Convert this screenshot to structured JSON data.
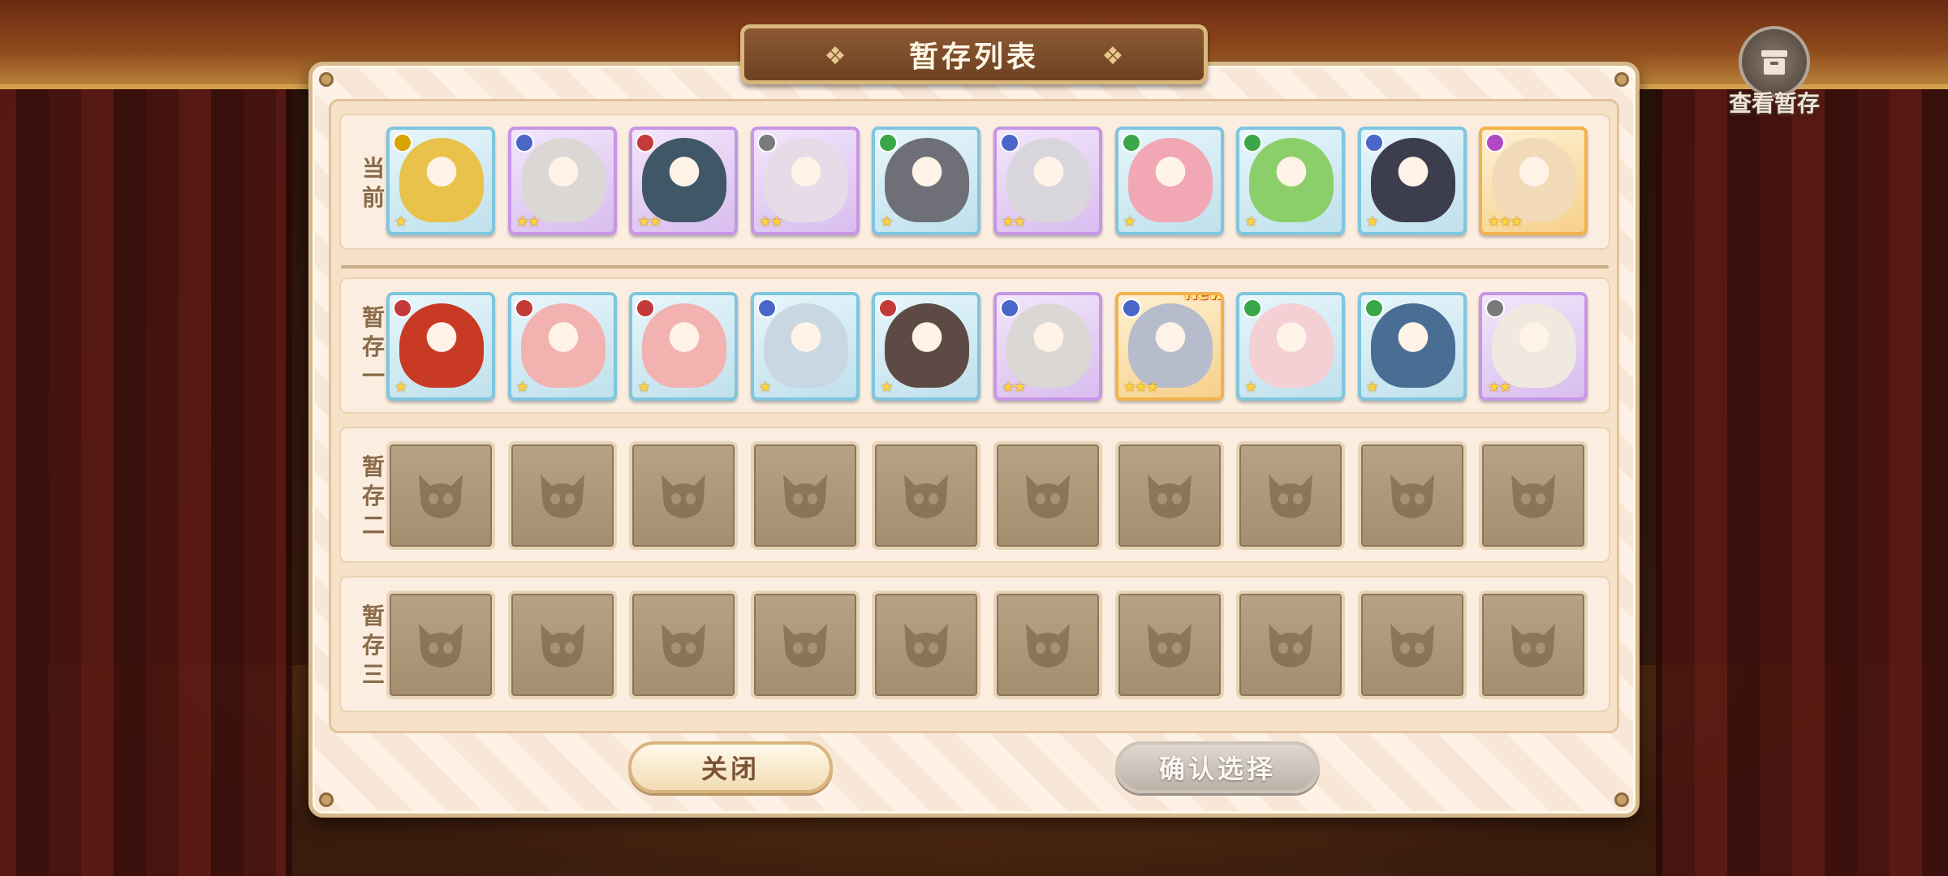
{
  "window": {
    "title": "暂存列表"
  },
  "view_stash_button": {
    "label": "查看暂存",
    "icon": "box-icon"
  },
  "rows": [
    {
      "label": [
        "当",
        "前"
      ],
      "slots": [
        {
          "rarity": 1,
          "stars": "★",
          "portrait": "#e8c24a",
          "element": "#d9a300"
        },
        {
          "rarity": 2,
          "stars": "★★",
          "portrait": "#dad7d4",
          "element": "#4a66c9"
        },
        {
          "rarity": 2,
          "stars": "★★",
          "portrait": "#3f5766",
          "element": "#c43a3a"
        },
        {
          "rarity": 2,
          "stars": "★★",
          "portrait": "#e6dbe6",
          "element": "#7a7a7a"
        },
        {
          "rarity": 1,
          "stars": "★",
          "portrait": "#6f6f78",
          "element": "#3aa84a"
        },
        {
          "rarity": 2,
          "stars": "★★",
          "portrait": "#d8d6dc",
          "element": "#4a66c9"
        },
        {
          "rarity": 1,
          "stars": "★",
          "portrait": "#f1a7b4",
          "element": "#3aa84a"
        },
        {
          "rarity": 1,
          "stars": "★",
          "portrait": "#8ccf6a",
          "element": "#3aa84a"
        },
        {
          "rarity": 1,
          "stars": "★",
          "portrait": "#3c3e4e",
          "element": "#4a66c9"
        },
        {
          "rarity": 3,
          "stars": "★★★",
          "portrait": "#f2d9b8",
          "element": "#b04ac4"
        }
      ]
    },
    {
      "label": [
        "暂",
        "存",
        "一"
      ],
      "slots": [
        {
          "rarity": 1,
          "stars": "★",
          "portrait": "#c83a24",
          "element": "#c43a3a"
        },
        {
          "rarity": 1,
          "stars": "★",
          "portrait": "#f2b2b0",
          "element": "#c43a3a"
        },
        {
          "rarity": 1,
          "stars": "★",
          "portrait": "#f2b2b0",
          "element": "#c43a3a"
        },
        {
          "rarity": 1,
          "stars": "★",
          "portrait": "#c9d7e3",
          "element": "#4a66c9"
        },
        {
          "rarity": 1,
          "stars": "★",
          "portrait": "#5e4a44",
          "element": "#c43a3a"
        },
        {
          "rarity": 2,
          "stars": "★★",
          "portrait": "#dad7d4",
          "element": "#4a66c9"
        },
        {
          "rarity": 3,
          "stars": "★★★",
          "portrait": "#b6bccc",
          "element": "#4a66c9",
          "badge": "New"
        },
        {
          "rarity": 1,
          "stars": "★",
          "portrait": "#f4cfd4",
          "element": "#3aa84a"
        },
        {
          "rarity": 1,
          "stars": "★",
          "portrait": "#4a6d94",
          "element": "#3aa84a"
        },
        {
          "rarity": 2,
          "stars": "★★",
          "portrait": "#efe9df",
          "element": "#7a7a7a"
        }
      ]
    },
    {
      "label": [
        "暂",
        "存",
        "二"
      ],
      "slots": "empty"
    },
    {
      "label": [
        "暂",
        "存",
        "三"
      ],
      "slots": "empty"
    }
  ],
  "buttons": {
    "close": "关闭",
    "confirm": "确认选择"
  },
  "colors": {
    "panel": "#fdf0e4",
    "banner": "#7a4a28",
    "confirm_disabled": "#bdb2a8"
  }
}
